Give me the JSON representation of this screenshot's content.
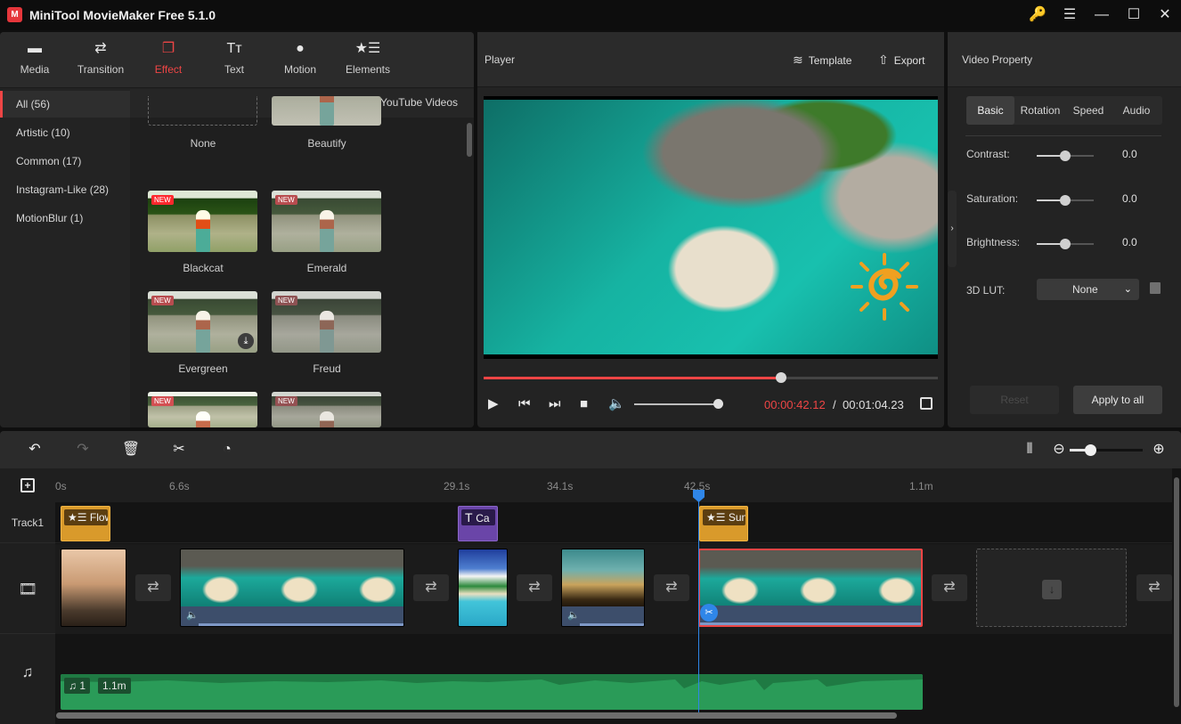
{
  "app": {
    "title": "MiniTool MovieMaker Free 5.1.0",
    "logo_glyph": "M",
    "window_controls": [
      {
        "name": "key-icon",
        "glyph": "🔑"
      },
      {
        "name": "menu-icon",
        "glyph": "☰"
      },
      {
        "name": "minimize-icon",
        "glyph": "—"
      },
      {
        "name": "maximize-icon",
        "glyph": "☐"
      },
      {
        "name": "close-icon",
        "glyph": "✕"
      }
    ]
  },
  "top_tabs": [
    {
      "label": "Media",
      "icon": "▬",
      "active": false
    },
    {
      "label": "Transition",
      "icon": "⇄",
      "active": false
    },
    {
      "label": "Effect",
      "icon": "❐",
      "active": true
    },
    {
      "label": "Text",
      "icon": "Tт",
      "active": false
    },
    {
      "label": "Motion",
      "icon": "●",
      "active": false
    },
    {
      "label": "Elements",
      "icon": "★☰",
      "active": false
    }
  ],
  "categories": [
    {
      "label": "All (56)",
      "active": true
    },
    {
      "label": "Artistic (10)",
      "active": false
    },
    {
      "label": "Common (17)",
      "active": false
    },
    {
      "label": "Instagram-Like (28)",
      "active": false
    },
    {
      "label": "MotionBlur (1)",
      "active": false
    }
  ],
  "download_youtube": "Download YouTube Videos",
  "effects": [
    {
      "label": "None",
      "is_new": false,
      "download": false
    },
    {
      "label": "Beautify",
      "is_new": false,
      "download": false
    },
    {
      "label": "Blackcat",
      "is_new": true,
      "download": false
    },
    {
      "label": "Emerald",
      "is_new": true,
      "download": false
    },
    {
      "label": "Evergreen",
      "is_new": true,
      "download": true
    },
    {
      "label": "Freud",
      "is_new": true,
      "download": false
    },
    {
      "label": "",
      "is_new": true,
      "download": false
    },
    {
      "label": "",
      "is_new": true,
      "download": false
    }
  ],
  "new_badge": "NEW",
  "player": {
    "title": "Player",
    "template_label": "Template",
    "export_label": "Export",
    "progress": 0.654,
    "volume": 1.0,
    "current_time": "00:00:42.12",
    "separator": "/",
    "total_time": "00:01:04.23"
  },
  "property": {
    "title": "Video Property",
    "tabs": [
      {
        "label": "Basic",
        "active": true
      },
      {
        "label": "Rotation",
        "active": false
      },
      {
        "label": "Speed",
        "active": false
      },
      {
        "label": "Audio",
        "active": false
      }
    ],
    "adjustments": [
      {
        "label": "Contrast:",
        "value": "0.0",
        "position": 0.5
      },
      {
        "label": "Saturation:",
        "value": "0.0",
        "position": 0.5
      },
      {
        "label": "Brightness:",
        "value": "0.0",
        "position": 0.5
      }
    ],
    "lut_label": "3D LUT:",
    "lut_value": "None",
    "reset_label": "Reset",
    "apply_all_label": "Apply to all"
  },
  "timeline": {
    "zoom_level": 0.28,
    "ruler_ticks": [
      "0s",
      "6.6s",
      "29.1s",
      "34.1s",
      "42.5s",
      "1.1m"
    ],
    "track1_label": "Track1",
    "element_clips": [
      {
        "label": "Flow",
        "type": "element",
        "color": "#d99a2b"
      },
      {
        "label": "Ca",
        "type": "text",
        "color": "#6a45a8"
      },
      {
        "label": "Sun",
        "type": "element",
        "color": "#d99a2b"
      }
    ],
    "audio": {
      "index": "1",
      "duration": "1.1m",
      "color": "#2a9b58"
    },
    "accent": "#ee4545",
    "playhead_color": "#2f86e8"
  }
}
